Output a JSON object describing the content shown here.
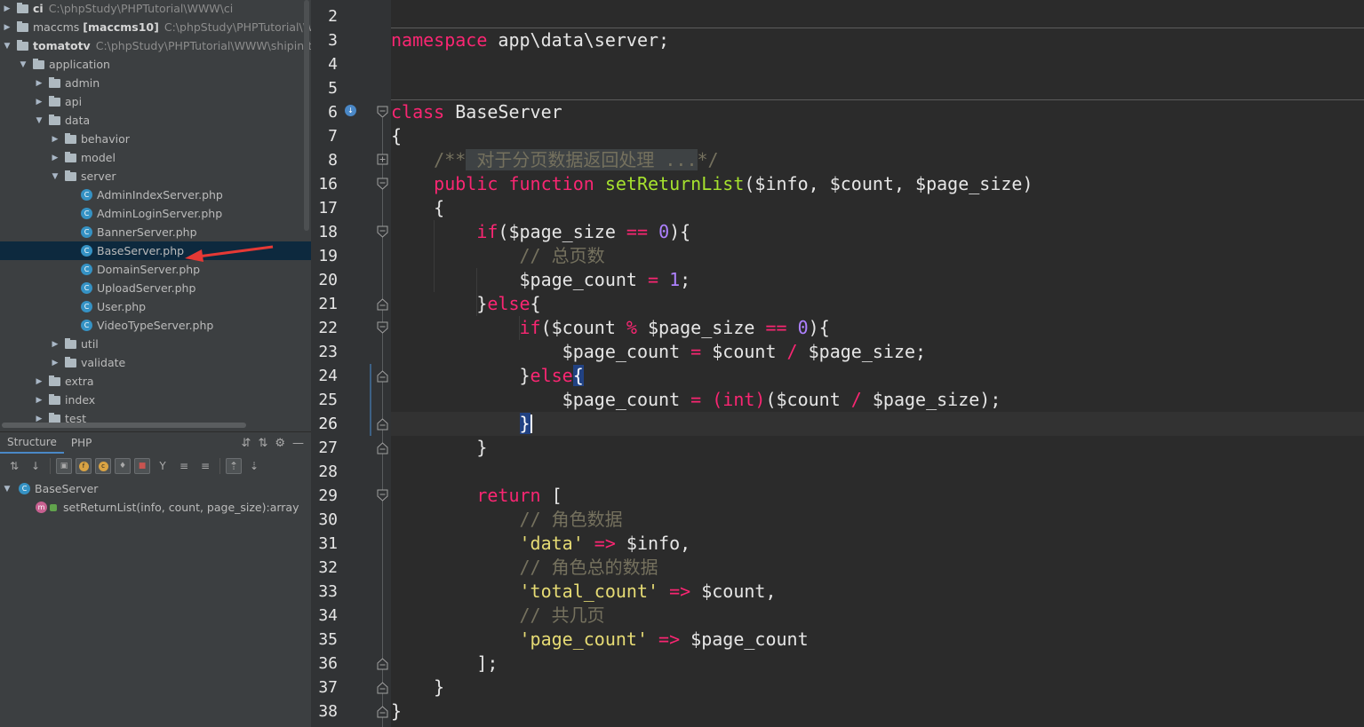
{
  "project_tree": {
    "rows": [
      {
        "indent": 0,
        "arrow": "▶",
        "icon": "folder",
        "name": "ci",
        "name_bold": true,
        "path": "C:\\phpStudy\\PHPTutorial\\WWW\\ci"
      },
      {
        "indent": 0,
        "arrow": "▶",
        "icon": "folder",
        "name": "maccms",
        "name_suffix": "[maccms10]",
        "path": "C:\\phpStudy\\PHPTutorial\\WWW"
      },
      {
        "indent": 0,
        "arrow": "▼",
        "icon": "folder",
        "name": "tomatotv",
        "name_bold": true,
        "path": "C:\\phpStudy\\PHPTutorial\\WWW\\shipin\\tom"
      },
      {
        "indent": 1,
        "arrow": "▼",
        "icon": "folder",
        "name": "application"
      },
      {
        "indent": 2,
        "arrow": "▶",
        "icon": "folder",
        "name": "admin"
      },
      {
        "indent": 2,
        "arrow": "▶",
        "icon": "folder",
        "name": "api"
      },
      {
        "indent": 2,
        "arrow": "▼",
        "icon": "folder",
        "name": "data"
      },
      {
        "indent": 3,
        "arrow": "▶",
        "icon": "folder",
        "name": "behavior"
      },
      {
        "indent": 3,
        "arrow": "▶",
        "icon": "folder",
        "name": "model"
      },
      {
        "indent": 3,
        "arrow": "▼",
        "icon": "folder",
        "name": "server"
      },
      {
        "indent": 4,
        "arrow": "",
        "icon": "class",
        "name": "AdminIndexServer.php"
      },
      {
        "indent": 4,
        "arrow": "",
        "icon": "class",
        "name": "AdminLoginServer.php"
      },
      {
        "indent": 4,
        "arrow": "",
        "icon": "class",
        "name": "BannerServer.php"
      },
      {
        "indent": 4,
        "arrow": "",
        "icon": "class",
        "name": "BaseServer.php",
        "selected": true
      },
      {
        "indent": 4,
        "arrow": "",
        "icon": "class",
        "name": "DomainServer.php"
      },
      {
        "indent": 4,
        "arrow": "",
        "icon": "class",
        "name": "UploadServer.php"
      },
      {
        "indent": 4,
        "arrow": "",
        "icon": "class",
        "name": "User.php"
      },
      {
        "indent": 4,
        "arrow": "",
        "icon": "class",
        "name": "VideoTypeServer.php"
      },
      {
        "indent": 3,
        "arrow": "▶",
        "icon": "folder",
        "name": "util"
      },
      {
        "indent": 3,
        "arrow": "▶",
        "icon": "folder",
        "name": "validate"
      },
      {
        "indent": 2,
        "arrow": "▶",
        "icon": "folder",
        "name": "extra"
      },
      {
        "indent": 2,
        "arrow": "▶",
        "icon": "folder",
        "name": "index"
      },
      {
        "indent": 2,
        "arrow": "▶",
        "icon": "folder",
        "name": "test"
      }
    ],
    "class_icon_letter": "C"
  },
  "structure_panel": {
    "tabs": [
      "Structure",
      "PHP"
    ],
    "root": "BaseServer",
    "method": "setReturnList(info, count, page_size):array",
    "method_icon_letter": "m"
  },
  "editor": {
    "colors": {
      "keyword": "#f92672",
      "function": "#a6e22e",
      "number": "#ae81ff",
      "string": "#e6db74",
      "comment": "#75715e",
      "text": "#e6e6e6"
    },
    "lines": [
      {
        "n": "2",
        "tokens": []
      },
      {
        "n": "3",
        "tokens": [
          {
            "t": "namespace",
            "c": "kw"
          },
          {
            "t": " app\\data\\server;"
          }
        ]
      },
      {
        "n": "4",
        "tokens": []
      },
      {
        "n": "5",
        "tokens": []
      },
      {
        "n": "6",
        "tokens": [
          {
            "t": "class",
            "c": "kw"
          },
          {
            "t": " BaseServer"
          }
        ]
      },
      {
        "n": "7",
        "tokens": [
          {
            "t": "{"
          }
        ]
      },
      {
        "n": "8",
        "tokens": [
          {
            "t": "    "
          },
          {
            "t": "/**",
            "c": "cm"
          },
          {
            "t": " 对于分页数据返回处理 ...",
            "c": "cm fold-box"
          },
          {
            "t": "*/",
            "c": "cm"
          }
        ]
      },
      {
        "n": "16",
        "tokens": [
          {
            "t": "    "
          },
          {
            "t": "public",
            "c": "kw"
          },
          {
            "t": " "
          },
          {
            "t": "function",
            "c": "kw"
          },
          {
            "t": " "
          },
          {
            "t": "setReturnList",
            "c": "fn"
          },
          {
            "t": "($info, $count, $page_size)"
          }
        ]
      },
      {
        "n": "17",
        "tokens": [
          {
            "t": "    {"
          }
        ]
      },
      {
        "n": "18",
        "tokens": [
          {
            "t": "        "
          },
          {
            "t": "if",
            "c": "kw"
          },
          {
            "t": "($page_size "
          },
          {
            "t": "==",
            "c": "op"
          },
          {
            "t": " "
          },
          {
            "t": "0",
            "c": "num"
          },
          {
            "t": "){"
          }
        ]
      },
      {
        "n": "19",
        "tokens": [
          {
            "t": "            "
          },
          {
            "t": "// 总页数",
            "c": "cm"
          }
        ]
      },
      {
        "n": "20",
        "tokens": [
          {
            "t": "            $page_count "
          },
          {
            "t": "=",
            "c": "op"
          },
          {
            "t": " "
          },
          {
            "t": "1",
            "c": "num"
          },
          {
            "t": ";"
          }
        ]
      },
      {
        "n": "21",
        "tokens": [
          {
            "t": "        }"
          },
          {
            "t": "else",
            "c": "kw"
          },
          {
            "t": "{"
          }
        ]
      },
      {
        "n": "22",
        "tokens": [
          {
            "t": "            "
          },
          {
            "t": "if",
            "c": "kw"
          },
          {
            "t": "($count "
          },
          {
            "t": "%",
            "c": "op"
          },
          {
            "t": " $page_size "
          },
          {
            "t": "==",
            "c": "op"
          },
          {
            "t": " "
          },
          {
            "t": "0",
            "c": "num"
          },
          {
            "t": "){"
          }
        ]
      },
      {
        "n": "23",
        "tokens": [
          {
            "t": "                $page_count "
          },
          {
            "t": "=",
            "c": "op"
          },
          {
            "t": " $count "
          },
          {
            "t": "/",
            "c": "op"
          },
          {
            "t": " $page_size;"
          }
        ]
      },
      {
        "n": "24",
        "tokens": [
          {
            "t": "            }"
          },
          {
            "t": "else",
            "c": "kw"
          },
          {
            "t": "{",
            "c": "brace-hl"
          }
        ]
      },
      {
        "n": "25",
        "tokens": [
          {
            "t": "                $page_count "
          },
          {
            "t": "=",
            "c": "op"
          },
          {
            "t": " "
          },
          {
            "t": "(int)",
            "c": "kw"
          },
          {
            "t": "($count "
          },
          {
            "t": "/",
            "c": "op"
          },
          {
            "t": " $page_size);"
          }
        ]
      },
      {
        "n": "26",
        "tokens": [
          {
            "t": "            "
          },
          {
            "t": "}",
            "c": "brace-hl"
          }
        ],
        "caret": true
      },
      {
        "n": "27",
        "tokens": [
          {
            "t": "        }"
          }
        ]
      },
      {
        "n": "28",
        "tokens": []
      },
      {
        "n": "29",
        "tokens": [
          {
            "t": "        "
          },
          {
            "t": "return",
            "c": "kw"
          },
          {
            "t": " ["
          }
        ]
      },
      {
        "n": "30",
        "tokens": [
          {
            "t": "            "
          },
          {
            "t": "// 角色数据",
            "c": "cm"
          }
        ]
      },
      {
        "n": "31",
        "tokens": [
          {
            "t": "            "
          },
          {
            "t": "'data'",
            "c": "str"
          },
          {
            "t": " "
          },
          {
            "t": "=>",
            "c": "op"
          },
          {
            "t": " $info,"
          }
        ]
      },
      {
        "n": "32",
        "tokens": [
          {
            "t": "            "
          },
          {
            "t": "// 角色总的数据",
            "c": "cm"
          }
        ]
      },
      {
        "n": "33",
        "tokens": [
          {
            "t": "            "
          },
          {
            "t": "'total_count'",
            "c": "str"
          },
          {
            "t": " "
          },
          {
            "t": "=>",
            "c": "op"
          },
          {
            "t": " $count,"
          }
        ]
      },
      {
        "n": "34",
        "tokens": [
          {
            "t": "            "
          },
          {
            "t": "// 共几页",
            "c": "cm"
          }
        ]
      },
      {
        "n": "35",
        "tokens": [
          {
            "t": "            "
          },
          {
            "t": "'page_count'",
            "c": "str"
          },
          {
            "t": " "
          },
          {
            "t": "=>",
            "c": "op"
          },
          {
            "t": " $page_count"
          }
        ]
      },
      {
        "n": "36",
        "tokens": [
          {
            "t": "        ];"
          }
        ]
      },
      {
        "n": "37",
        "tokens": [
          {
            "t": "    }"
          }
        ]
      },
      {
        "n": "38",
        "tokens": [
          {
            "t": "}"
          }
        ]
      }
    ]
  }
}
